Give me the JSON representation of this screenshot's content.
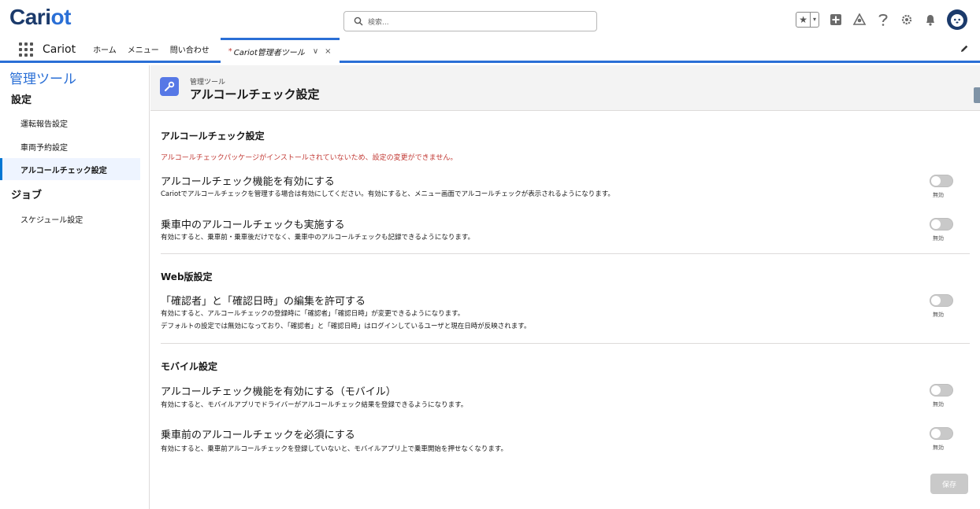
{
  "header": {
    "logo_main": "Cari",
    "logo_accent": "ot",
    "search_placeholder": "検索...",
    "favorites_star": "★",
    "favorites_caret": "▾",
    "icons": [
      "star-icon",
      "add-icon",
      "trailhead-icon",
      "help-icon",
      "setup-gear-icon",
      "notification-bell-icon",
      "avatar"
    ]
  },
  "navbar": {
    "app_name": "Cariot",
    "items": [
      "ホーム",
      "メニュー",
      "問い合わせ"
    ],
    "active_tab": {
      "asterisk": "*",
      "label": "Cariot管理者ツール",
      "chevron": "∨",
      "close": "×"
    }
  },
  "sidebar": {
    "title": "管理ツール",
    "groups": [
      {
        "heading": "設定",
        "items": [
          "運転報告設定",
          "車両予約設定",
          "アルコールチェック設定"
        ]
      },
      {
        "heading": "ジョブ",
        "items": [
          "スケジュール設定"
        ]
      }
    ],
    "active_item": "アルコールチェック設定"
  },
  "page": {
    "subtitle": "管理ツール",
    "title": "アルコールチェック設定"
  },
  "sections": [
    {
      "title": "アルコールチェック設定",
      "warning": "アルコールチェックパッケージがインストールされていないため、設定の変更ができません。",
      "options": [
        {
          "title": "アルコールチェック機能を有効にする",
          "desc": [
            "Cariotでアルコールチェックを管理する場合は有効にしてください。有効にすると、メニュー画面でアルコールチェックが表示されるようになります。"
          ],
          "toggle_label": "無効",
          "enabled": false
        },
        {
          "title": "乗車中のアルコールチェックも実施する",
          "desc": [
            "有効にすると、乗車前・乗車後だけでなく、乗車中のアルコールチェックも記録できるようになります。"
          ],
          "toggle_label": "無効",
          "enabled": false
        }
      ]
    },
    {
      "title": "Web版設定",
      "options": [
        {
          "title": "「確認者」と「確認日時」の編集を許可する",
          "desc": [
            "有効にすると、アルコールチェックの登録時に「確認者」「確認日時」が変更できるようになります。",
            "デフォルトの設定では無効になっており、「確認者」と「確認日時」はログインしているユーザと現在日時が反映されます。"
          ],
          "toggle_label": "無効",
          "enabled": false
        }
      ]
    },
    {
      "title": "モバイル設定",
      "options": [
        {
          "title": "アルコールチェック機能を有効にする（モバイル）",
          "desc": [
            "有効にすると、モバイルアプリでドライバーがアルコールチェック結果を登録できるようになります。"
          ],
          "toggle_label": "無効",
          "enabled": false
        },
        {
          "title": "乗車前のアルコールチェックを必須にする",
          "desc": [
            "有効にすると、乗車前アルコールチェックを登録していないと、モバイルアプリ上で乗車開始を押せなくなります。"
          ],
          "toggle_label": "無効",
          "enabled": false
        }
      ]
    }
  ],
  "save_button": "保存",
  "colors": {
    "brand_dark": "#1b3a6b",
    "brand_blue": "#2a6fd6",
    "warning_red": "#c23934",
    "toggle_off": "#c9c9c9"
  }
}
